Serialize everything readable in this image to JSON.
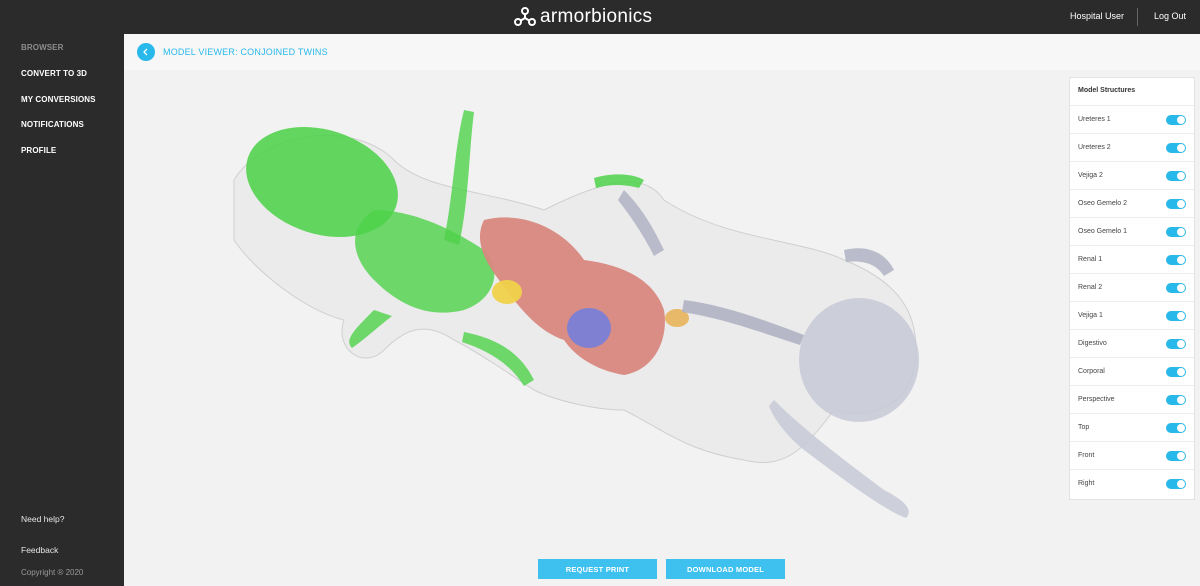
{
  "brand": {
    "name": "armorbionics",
    "logo_icon": "armorbionics-logo-icon"
  },
  "header": {
    "user_name": "Hospital User",
    "logout_label": "Log Out"
  },
  "sidebar": {
    "items": [
      {
        "label": "BROWSER",
        "active": false
      },
      {
        "label": "CONVERT TO 3D",
        "active": true
      },
      {
        "label": "MY CONVERSIONS",
        "active": true
      },
      {
        "label": "NOTIFICATIONS",
        "active": true
      },
      {
        "label": "PROFILE",
        "active": true
      }
    ],
    "help_label": "Need help?",
    "feedback_label": "Feedback",
    "copyright": "Copyright ® 2020"
  },
  "viewer": {
    "title": "MODEL VIEWER: CONJOINED TWINS",
    "back_icon": "chevron-left-icon"
  },
  "structures": {
    "title": "Model Structures",
    "items": [
      {
        "label": "Ureteres 1",
        "on": true
      },
      {
        "label": "Ureteres 2",
        "on": true
      },
      {
        "label": "Vejiga 2",
        "on": true
      },
      {
        "label": "Oseo Gemelo 2",
        "on": true
      },
      {
        "label": "Oseo Gemelo 1",
        "on": true
      },
      {
        "label": "Renal 1",
        "on": true
      },
      {
        "label": "Renal 2",
        "on": true
      },
      {
        "label": "Vejiga 1",
        "on": true
      },
      {
        "label": "Digestivo",
        "on": true
      },
      {
        "label": "Corporal",
        "on": true
      },
      {
        "label": "Perspective",
        "on": true
      },
      {
        "label": "Top",
        "on": true
      },
      {
        "label": "Front",
        "on": true
      },
      {
        "label": "Right",
        "on": true
      }
    ]
  },
  "actions": {
    "request_print": "REQUEST PRINT",
    "download_model": "DOWNLOAD MODEL"
  },
  "colors": {
    "accent": "#29b8ea",
    "dark": "#2b2b2b",
    "twin_green": "#4fd24a",
    "intestine_pink": "#d98880",
    "kidney_blue": "#7a7fd6",
    "bladder_yellow": "#f0d24a",
    "bone_grey": "#c7c9d6"
  }
}
